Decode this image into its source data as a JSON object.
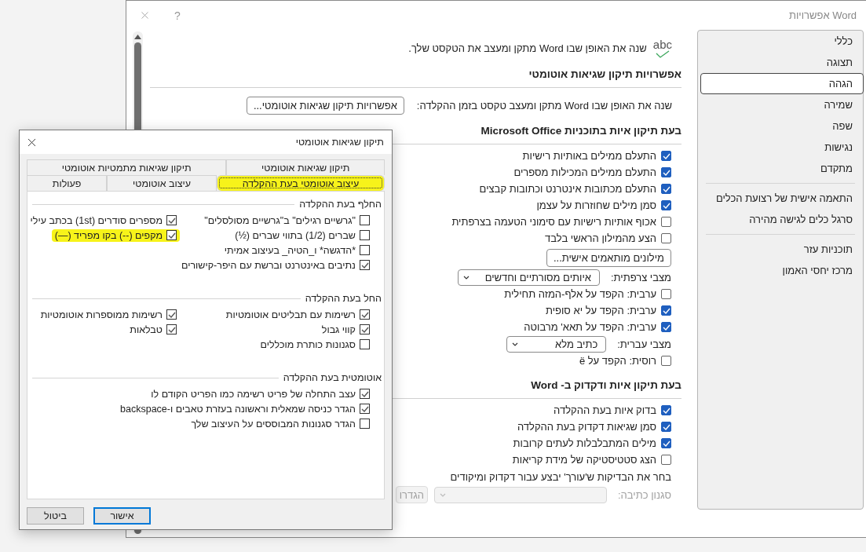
{
  "window": {
    "title": "אפשרויות Word",
    "help": "?"
  },
  "content": {
    "intro": {
      "icon_label": "abc",
      "text": "שנה את האופן שבו Word מתקן ומעצב את הטקסט שלך."
    },
    "sections": [
      {
        "heading": "אפשרויות תיקון שגיאות אוטומטי",
        "rows": [
          {
            "kind": "label_button",
            "label": "שנה את האופן שבו Word מתקן ומעצב טקסט בזמן ההקלדה:",
            "button": "אפשרויות תיקון שגיאות אוטומטי..."
          }
        ]
      },
      {
        "heading": "בעת תיקון איות בתוכניות Microsoft Office",
        "rows": [
          {
            "kind": "checkbox",
            "label": "התעלם ממילים באותיות רישיות",
            "checked": true
          },
          {
            "kind": "checkbox",
            "label": "התעלם ממילים המכילות מספרים",
            "checked": true
          },
          {
            "kind": "checkbox",
            "label": "התעלם מכתובות אינטרנט וכתובות קבצים",
            "checked": true
          },
          {
            "kind": "checkbox",
            "label": "סמן מילים שחוזרות על עצמן",
            "checked": true
          },
          {
            "kind": "checkbox",
            "label": "אכוף אותיות רישיות עם סימוני הטעמה בצרפתית",
            "checked": false
          },
          {
            "kind": "checkbox",
            "label": "הצע מהמילון הראשי בלבד",
            "checked": false
          },
          {
            "kind": "button",
            "button": "מילונים מותאמים אישית..."
          },
          {
            "kind": "select",
            "label": "מצבי צרפתית:",
            "value": "איותים מסורתיים וחדשים"
          },
          {
            "kind": "checkbox",
            "label": "ערבית: הקפד על אלף-המזה תחילית",
            "checked": false
          },
          {
            "kind": "checkbox",
            "label": "ערבית: הקפד על יא סופית",
            "checked": true
          },
          {
            "kind": "checkbox",
            "label": "ערבית: הקפד על תאא' מרבוטה",
            "checked": true
          },
          {
            "kind": "select",
            "label": "מצבי עברית:",
            "value": "כתיב מלא"
          },
          {
            "kind": "checkbox",
            "label": "רוסית: הקפד על ë",
            "checked": false
          }
        ]
      },
      {
        "heading": "בעת תיקון איות ודקדוק ב- Word",
        "rows": [
          {
            "kind": "checkbox",
            "label": "בדוק איות בעת ההקלדה",
            "checked": true
          },
          {
            "kind": "checkbox",
            "label": "סמן שגיאות דקדוק בעת ההקלדה",
            "checked": true
          },
          {
            "kind": "checkbox",
            "label": "מילים המתבלבלות לעתים קרובות",
            "checked": true
          },
          {
            "kind": "checkbox",
            "label": "הצג סטטיסטיקה של מידת קריאות",
            "checked": false
          },
          {
            "kind": "text",
            "label": "בחר את הבדיקות ש'עורך' יבצע עבור דקדוק ומיקודים"
          },
          {
            "kind": "select_button",
            "label": "סגנון כתיבה:",
            "button": "הגדרו",
            "disabled": true
          }
        ]
      }
    ]
  },
  "sidebar": {
    "groups": [
      {
        "items": [
          {
            "label": "כללי",
            "selected": false
          },
          {
            "label": "תצוגה",
            "selected": false
          },
          {
            "label": "הגהה",
            "selected": true
          },
          {
            "label": "שמירה",
            "selected": false
          },
          {
            "label": "שפה",
            "selected": false
          },
          {
            "label": "נגישות",
            "selected": false
          },
          {
            "label": "מתקדם",
            "selected": false
          }
        ]
      },
      {
        "items": [
          {
            "label": "התאמה אישית של רצועת הכלים",
            "selected": false
          },
          {
            "label": "סרגל כלים לגישה מהירה",
            "selected": false
          }
        ]
      },
      {
        "items": [
          {
            "label": "תוכניות עזר",
            "selected": false
          },
          {
            "label": "מרכז יחסי האמון",
            "selected": false
          }
        ]
      }
    ]
  },
  "dialog": {
    "title": "תיקון שגיאות אוטומטי",
    "tab_rows": [
      [
        {
          "label": "תיקון שגיאות אוטומטי",
          "selected": false,
          "highlighted": false
        },
        {
          "label": "תיקון שגיאות מתמטיות אוטומטי",
          "selected": false,
          "highlighted": false
        }
      ],
      [
        {
          "label": "עיצוב אוטומטי בעת ההקלדה",
          "selected": true,
          "highlighted": true
        },
        {
          "label": "עיצוב אוטומטי",
          "selected": false,
          "highlighted": false
        },
        {
          "label": "פעולות",
          "selected": false,
          "highlighted": false
        }
      ]
    ],
    "groups": [
      {
        "title": "החלף בעת ההקלדה",
        "columns": [
          [
            {
              "label": "\"גרשיים רגילים\" ב\"גרשיים מסולסלים\"",
              "checked": false,
              "highlighted": false
            },
            {
              "label": "שברים (1/2) בתווי שברים (½)",
              "checked": false,
              "highlighted": false
            },
            {
              "label": "*הדגשה* ו_הטיה_ בעיצוב אמיתי",
              "checked": false,
              "highlighted": false
            },
            {
              "label": "נתיבים באינטרנט וברשת עם היפר-קישורים",
              "checked": true,
              "highlighted": false
            }
          ],
          [
            {
              "label": "מספרים סודרים (1st) בכתב עילי",
              "checked": true,
              "highlighted": false
            },
            {
              "label": "מקפים (--) בקו מפריד (—)",
              "checked": true,
              "highlighted": true
            }
          ]
        ]
      },
      {
        "title": "החל בעת ההקלדה",
        "columns": [
          [
            {
              "label": "רשימות עם תבליטים אוטומטיות",
              "checked": true,
              "highlighted": false
            },
            {
              "label": "קווי גבול",
              "checked": true,
              "highlighted": false
            },
            {
              "label": "סגנונות כותרת מוכללים",
              "checked": false,
              "highlighted": false
            }
          ],
          [
            {
              "label": "רשימות ממוספרות אוטומטיות",
              "checked": true,
              "highlighted": false
            },
            {
              "label": "טבלאות",
              "checked": true,
              "highlighted": false
            }
          ]
        ]
      },
      {
        "title": "אוטומטית בעת ההקלדה",
        "columns": [
          [
            {
              "label": "עצב התחלה של פריט רשימה כמו הפריט הקודם לו",
              "checked": true,
              "highlighted": false
            },
            {
              "label": "הגדר כניסה שמאלית וראשונה בעזרת טאבים ו-backspace",
              "checked": true,
              "highlighted": false
            },
            {
              "label": "הגדר סגנונות המבוססים על העיצוב שלך",
              "checked": false,
              "highlighted": false
            }
          ]
        ]
      }
    ],
    "buttons": [
      {
        "label": "אישור",
        "default": true
      },
      {
        "label": "ביטול",
        "default": false
      }
    ]
  }
}
